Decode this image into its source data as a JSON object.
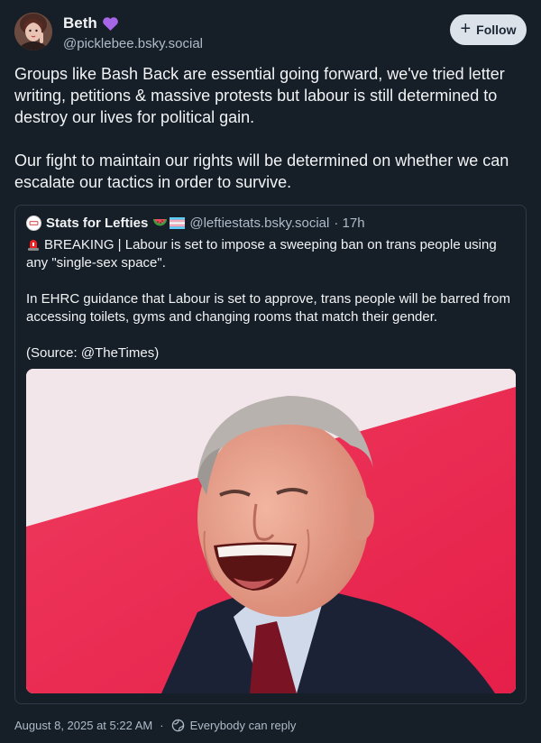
{
  "post": {
    "display_name": "Beth",
    "name_emoji": "purple-heart",
    "handle": "@picklebee.bsky.social",
    "follow_label": "Follow",
    "text": "Groups like Bash Back are essential going forward, we've tried letter writing, petitions & massive protests but labour is still determined to destroy our lives for political gain.\n\nOur fight to maintain our rights will be determined on whether we can escalate our tactics in order to survive."
  },
  "quote": {
    "display_name": "Stats for Lefties",
    "handle": "@leftiestats.bsky.social",
    "time": "· 17h",
    "text": "BREAKING | Labour is set to impose a sweeping ban on trans people using any \"single-sex space\".\n\nIn EHRC guidance that Labour is set to approve, trans people will be barred from accessing toilets, gyms and changing rooms that match their gender.\n\n(Source: @TheTimes)",
    "image_icon": "laughing-man-photo"
  },
  "footer": {
    "timestamp": "August 8, 2025 at 5:22 AM",
    "reply_setting": "Everybody can reply"
  },
  "colors": {
    "background": "#161e27",
    "text": "#f1f3f5",
    "muted": "#aebbc9",
    "follow_bg": "#dce2ea",
    "border": "#2e3a48",
    "photo_red": "#e8274f"
  }
}
